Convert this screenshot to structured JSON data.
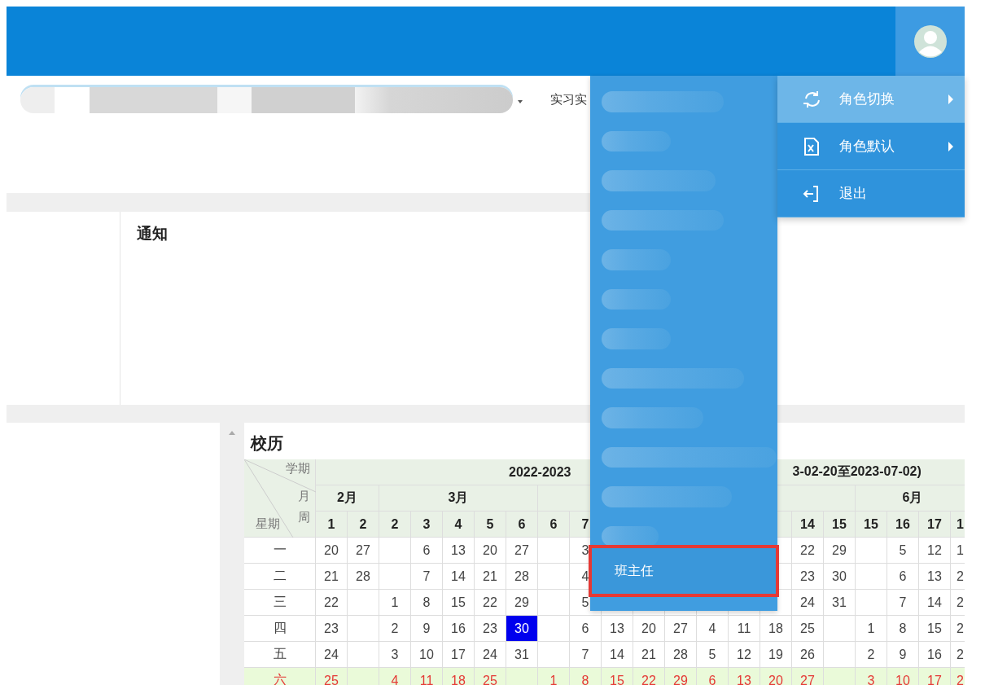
{
  "nav": {
    "items": [
      {
        "label": "实习实",
        "kind": "menu"
      }
    ]
  },
  "notice": {
    "title": "通知"
  },
  "calendar": {
    "title": "校历",
    "corner": {
      "term": "学期",
      "month": "月",
      "week": "周",
      "weekday": "星期"
    },
    "term_left": "2022-2023",
    "term_right": "3-02-20至2023-07-02)",
    "months": [
      {
        "label": "2月",
        "weeks": [
          {
            "kind": "week",
            "label": "1"
          },
          {
            "kind": "week",
            "label": "2"
          }
        ]
      },
      {
        "label": "3月",
        "weeks": [
          {
            "kind": "week",
            "label": "2"
          },
          {
            "kind": "week",
            "label": "3"
          },
          {
            "kind": "week",
            "label": "4"
          },
          {
            "kind": "week",
            "label": "5"
          },
          {
            "kind": "week",
            "label": "6"
          }
        ]
      },
      {
        "weeks": [
          {
            "kind": "week",
            "label": "6"
          },
          {
            "kind": "week",
            "label": "7"
          },
          {
            "kind": "blank"
          },
          {
            "kind": "blank"
          },
          {
            "kind": "blank"
          }
        ]
      },
      {
        "weeks": [
          {
            "kind": "blank"
          },
          {
            "kind": "blank"
          },
          {
            "kind": "blank"
          },
          {
            "kind": "week",
            "label": "14"
          },
          {
            "kind": "week",
            "label": "15"
          }
        ]
      },
      {
        "label": "6月",
        "weeks": [
          {
            "kind": "week",
            "label": "15"
          },
          {
            "kind": "week",
            "label": "16"
          },
          {
            "kind": "week",
            "label": "17"
          },
          {
            "kind": "week",
            "label": "1"
          }
        ]
      }
    ],
    "rows": [
      {
        "day": "一",
        "weekend": false,
        "cells": [
          {
            "kind": "date",
            "v": "20",
            "today": false
          },
          {
            "kind": "date",
            "v": "27",
            "today": false
          },
          {
            "kind": "blank"
          },
          {
            "kind": "date",
            "v": "6",
            "today": false
          },
          {
            "kind": "date",
            "v": "13",
            "today": false
          },
          {
            "kind": "date",
            "v": "20",
            "today": false
          },
          {
            "kind": "date",
            "v": "27",
            "today": false
          },
          {
            "kind": "blank"
          },
          {
            "kind": "date",
            "v": "3",
            "today": false
          },
          {
            "kind": "blank"
          },
          {
            "kind": "blank"
          },
          {
            "kind": "blank"
          },
          {
            "kind": "blank"
          },
          {
            "kind": "blank"
          },
          {
            "kind": "blank"
          },
          {
            "kind": "date",
            "v": "22",
            "today": false
          },
          {
            "kind": "date",
            "v": "29",
            "today": false
          },
          {
            "kind": "blank"
          },
          {
            "kind": "date",
            "v": "5",
            "today": false
          },
          {
            "kind": "date",
            "v": "12",
            "today": false
          },
          {
            "kind": "date",
            "v": "1",
            "today": false
          }
        ]
      },
      {
        "day": "二",
        "weekend": false,
        "cells": [
          {
            "kind": "date",
            "v": "21",
            "today": false
          },
          {
            "kind": "date",
            "v": "28",
            "today": false
          },
          {
            "kind": "blank"
          },
          {
            "kind": "date",
            "v": "7",
            "today": false
          },
          {
            "kind": "date",
            "v": "14",
            "today": false
          },
          {
            "kind": "date",
            "v": "21",
            "today": false
          },
          {
            "kind": "date",
            "v": "28",
            "today": false
          },
          {
            "kind": "blank"
          },
          {
            "kind": "date",
            "v": "4",
            "today": false
          },
          {
            "kind": "blank"
          },
          {
            "kind": "blank"
          },
          {
            "kind": "blank"
          },
          {
            "kind": "blank"
          },
          {
            "kind": "blank"
          },
          {
            "kind": "blank"
          },
          {
            "kind": "date",
            "v": "23",
            "today": false
          },
          {
            "kind": "date",
            "v": "30",
            "today": false
          },
          {
            "kind": "blank"
          },
          {
            "kind": "date",
            "v": "6",
            "today": false
          },
          {
            "kind": "date",
            "v": "13",
            "today": false
          },
          {
            "kind": "date",
            "v": "2",
            "today": false
          }
        ]
      },
      {
        "day": "三",
        "weekend": false,
        "cells": [
          {
            "kind": "date",
            "v": "22",
            "today": false
          },
          {
            "kind": "blank"
          },
          {
            "kind": "date",
            "v": "1",
            "today": false
          },
          {
            "kind": "date",
            "v": "8",
            "today": false
          },
          {
            "kind": "date",
            "v": "15",
            "today": false
          },
          {
            "kind": "date",
            "v": "22",
            "today": false
          },
          {
            "kind": "date",
            "v": "29",
            "today": false
          },
          {
            "kind": "blank"
          },
          {
            "kind": "date",
            "v": "5",
            "today": false
          },
          {
            "kind": "blank"
          },
          {
            "kind": "blank"
          },
          {
            "kind": "blank"
          },
          {
            "kind": "blank"
          },
          {
            "kind": "blank"
          },
          {
            "kind": "blank"
          },
          {
            "kind": "date",
            "v": "24",
            "today": false
          },
          {
            "kind": "date",
            "v": "31",
            "today": false
          },
          {
            "kind": "blank"
          },
          {
            "kind": "date",
            "v": "7",
            "today": false
          },
          {
            "kind": "date",
            "v": "14",
            "today": false
          },
          {
            "kind": "date",
            "v": "2",
            "today": false
          }
        ]
      },
      {
        "day": "四",
        "weekend": false,
        "cells": [
          {
            "kind": "date",
            "v": "23",
            "today": false
          },
          {
            "kind": "blank"
          },
          {
            "kind": "date",
            "v": "2",
            "today": false
          },
          {
            "kind": "date",
            "v": "9",
            "today": false
          },
          {
            "kind": "date",
            "v": "16",
            "today": false
          },
          {
            "kind": "date",
            "v": "23",
            "today": false
          },
          {
            "kind": "date",
            "v": "30",
            "today": true
          },
          {
            "kind": "blank"
          },
          {
            "kind": "date",
            "v": "6",
            "today": false
          },
          {
            "kind": "date",
            "v": "13",
            "today": false
          },
          {
            "kind": "date",
            "v": "20",
            "today": false
          },
          {
            "kind": "date",
            "v": "27",
            "today": false
          },
          {
            "kind": "date",
            "v": "4",
            "today": false
          },
          {
            "kind": "date",
            "v": "11",
            "today": false
          },
          {
            "kind": "date",
            "v": "18",
            "today": false
          },
          {
            "kind": "date",
            "v": "25",
            "today": false
          },
          {
            "kind": "blank"
          },
          {
            "kind": "date",
            "v": "1",
            "today": false
          },
          {
            "kind": "date",
            "v": "8",
            "today": false
          },
          {
            "kind": "date",
            "v": "15",
            "today": false
          },
          {
            "kind": "date",
            "v": "2",
            "today": false
          }
        ]
      },
      {
        "day": "五",
        "weekend": false,
        "cells": [
          {
            "kind": "date",
            "v": "24",
            "today": false
          },
          {
            "kind": "blank"
          },
          {
            "kind": "date",
            "v": "3",
            "today": false
          },
          {
            "kind": "date",
            "v": "10",
            "today": false
          },
          {
            "kind": "date",
            "v": "17",
            "today": false
          },
          {
            "kind": "date",
            "v": "24",
            "today": false
          },
          {
            "kind": "date",
            "v": "31",
            "today": false
          },
          {
            "kind": "blank"
          },
          {
            "kind": "date",
            "v": "7",
            "today": false
          },
          {
            "kind": "date",
            "v": "14",
            "today": false
          },
          {
            "kind": "date",
            "v": "21",
            "today": false
          },
          {
            "kind": "date",
            "v": "28",
            "today": false
          },
          {
            "kind": "date",
            "v": "5",
            "today": false
          },
          {
            "kind": "date",
            "v": "12",
            "today": false
          },
          {
            "kind": "date",
            "v": "19",
            "today": false
          },
          {
            "kind": "date",
            "v": "26",
            "today": false
          },
          {
            "kind": "blank"
          },
          {
            "kind": "date",
            "v": "2",
            "today": false
          },
          {
            "kind": "date",
            "v": "9",
            "today": false
          },
          {
            "kind": "date",
            "v": "16",
            "today": false
          },
          {
            "kind": "date",
            "v": "2",
            "today": false
          }
        ]
      },
      {
        "day": "六",
        "weekend": true,
        "cells": [
          {
            "kind": "date",
            "v": "25",
            "today": false
          },
          {
            "kind": "blank"
          },
          {
            "kind": "date",
            "v": "4",
            "today": false
          },
          {
            "kind": "date",
            "v": "11",
            "today": false
          },
          {
            "kind": "date",
            "v": "18",
            "today": false
          },
          {
            "kind": "date",
            "v": "25",
            "today": false
          },
          {
            "kind": "blank"
          },
          {
            "kind": "date",
            "v": "1",
            "today": false
          },
          {
            "kind": "date",
            "v": "8",
            "today": false
          },
          {
            "kind": "date",
            "v": "15",
            "today": false
          },
          {
            "kind": "date",
            "v": "22",
            "today": false
          },
          {
            "kind": "date",
            "v": "29",
            "today": false
          },
          {
            "kind": "date",
            "v": "6",
            "today": false
          },
          {
            "kind": "date",
            "v": "13",
            "today": false
          },
          {
            "kind": "date",
            "v": "20",
            "today": false
          },
          {
            "kind": "date",
            "v": "27",
            "today": false
          },
          {
            "kind": "blank"
          },
          {
            "kind": "date",
            "v": "3",
            "today": false
          },
          {
            "kind": "date",
            "v": "10",
            "today": false
          },
          {
            "kind": "date",
            "v": "17",
            "today": false
          },
          {
            "kind": "date",
            "v": "2",
            "today": false
          }
        ]
      }
    ]
  },
  "dropdown": {
    "items": [
      {
        "label": "班主任",
        "annotated": true
      }
    ]
  },
  "role_menu": {
    "items": [
      {
        "label": "角色切换",
        "kind": "switch",
        "selected": true,
        "has_submenu": true
      },
      {
        "label": "角色默认",
        "kind": "default",
        "selected": false,
        "has_submenu": true
      },
      {
        "label": "退出",
        "kind": "logout",
        "selected": false,
        "has_submenu": false
      }
    ]
  }
}
